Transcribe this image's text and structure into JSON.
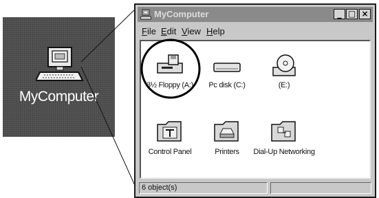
{
  "desktop": {
    "label": "MyComputer",
    "icon": "my-computer-icon"
  },
  "window": {
    "title": "MyComputer",
    "title_icon": "my-computer-icon",
    "controls": {
      "minimize": "_",
      "maximize": "□",
      "close": "×"
    }
  },
  "menu": [
    {
      "accel": "F",
      "rest": "ile"
    },
    {
      "accel": "E",
      "rest": "dit"
    },
    {
      "accel": "V",
      "rest": "iew"
    },
    {
      "accel": "H",
      "rest": "elp"
    }
  ],
  "items": [
    {
      "label": "3½ Floppy (A:)",
      "icon": "floppy-drive-icon",
      "highlighted": true
    },
    {
      "label": "Pc disk (C:)",
      "icon": "hard-disk-icon"
    },
    {
      "label": "(E:)",
      "icon": "cd-drive-icon"
    },
    {
      "label": "Control Panel",
      "icon": "control-panel-icon"
    },
    {
      "label": "Printers",
      "icon": "printers-icon"
    },
    {
      "label": "Dial-Up Networking",
      "icon": "dialup-networking-icon"
    }
  ],
  "status": {
    "text": "6 object(s)"
  }
}
